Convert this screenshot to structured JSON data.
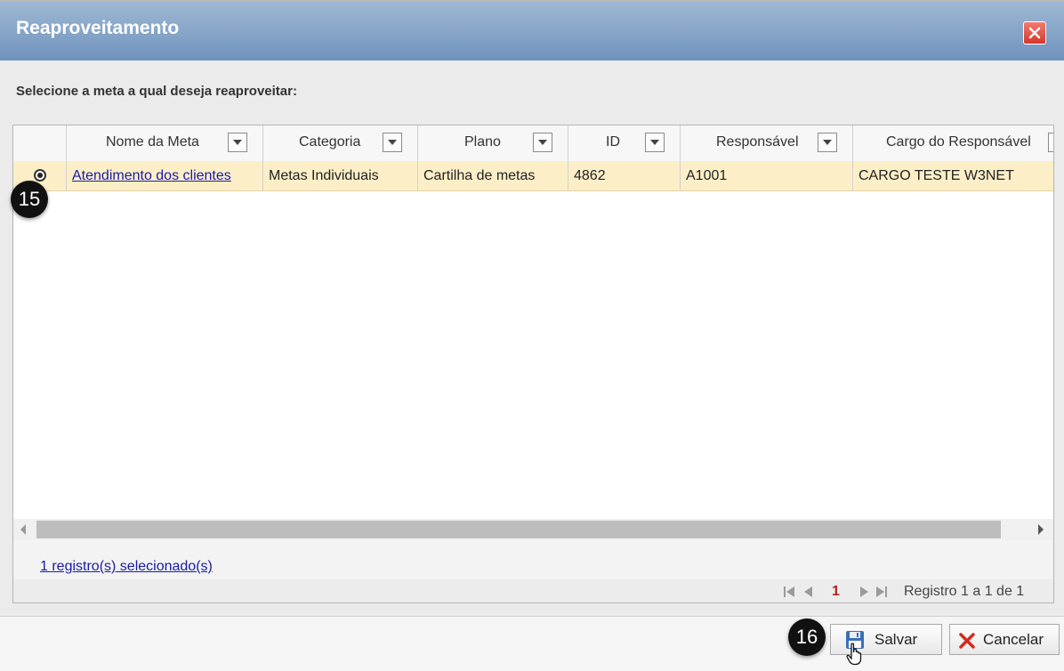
{
  "dialog": {
    "title": "Reaproveitamento",
    "instruction": "Selecione a meta a qual deseja reaproveitar:"
  },
  "grid": {
    "columns": [
      "Nome da Meta",
      "Categoria",
      "Plano",
      "ID",
      "Responsável",
      "Cargo do Responsável"
    ],
    "rows": [
      {
        "selected": true,
        "nome_da_meta": "Atendimento dos clientes",
        "categoria": "Metas Individuais",
        "plano": "Cartilha de metas",
        "id": "4862",
        "responsavel": "A1001",
        "cargo": "CARGO TESTE W3NET"
      }
    ],
    "selection_summary": "1 registro(s) selecionado(s)",
    "pager": {
      "current_page": "1",
      "info": "Registro 1 a 1 de 1"
    }
  },
  "buttons": {
    "save": "Salvar",
    "cancel": "Cancelar"
  },
  "annotations": {
    "step_radio": "15",
    "step_save": "16"
  },
  "icons": [
    "close-icon",
    "filter-dropdown-icon",
    "save-disk-icon",
    "cancel-x-icon",
    "hand-cursor-icon",
    "first-page-icon",
    "prev-page-icon",
    "next-page-icon",
    "last-page-icon"
  ]
}
